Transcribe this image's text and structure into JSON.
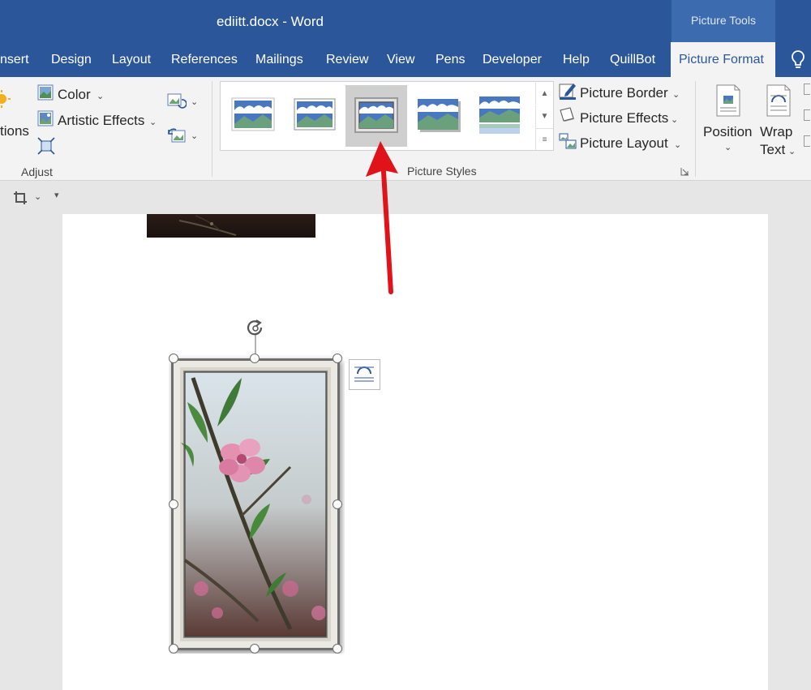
{
  "window": {
    "title": "ediitt.docx  -  Word",
    "context_tab_group": "Picture Tools"
  },
  "tabs": [
    {
      "label": "nsert"
    },
    {
      "label": "Design"
    },
    {
      "label": "Layout"
    },
    {
      "label": "References"
    },
    {
      "label": "Mailings"
    },
    {
      "label": "Review"
    },
    {
      "label": "View"
    },
    {
      "label": "Pens"
    },
    {
      "label": "Developer"
    },
    {
      "label": "Help"
    },
    {
      "label": "QuillBot"
    },
    {
      "label": "Picture Format",
      "active": true
    }
  ],
  "ribbon": {
    "adjust": {
      "corrections_partial": "tions",
      "color": "Color",
      "artistic_effects": "Artistic Effects",
      "group_label": "Adjust"
    },
    "picture_styles": {
      "group_label": "Picture Styles",
      "selected_index": 2,
      "picture_border": "Picture Border",
      "picture_effects": "Picture Effects",
      "picture_layout": "Picture Layout"
    },
    "arrange": {
      "position": "Position",
      "wrap_line1": "Wrap",
      "wrap_line2": "Text"
    }
  },
  "colors": {
    "title_bar": "#2b579a",
    "context_tab": "#3d6bb0",
    "ribbon_bg": "#f3f3f3",
    "annotation_arrow": "#e0131b"
  },
  "icons": [
    "corrections-icon",
    "color-icon",
    "artistic-effects-icon",
    "compress-pictures-icon",
    "change-picture-icon",
    "reset-picture-icon",
    "picture-border-icon",
    "picture-effects-icon",
    "picture-layout-icon",
    "position-icon",
    "wrap-text-icon",
    "lightbulb-icon",
    "crop-icon",
    "rotate-handle-icon",
    "layout-options-icon"
  ]
}
